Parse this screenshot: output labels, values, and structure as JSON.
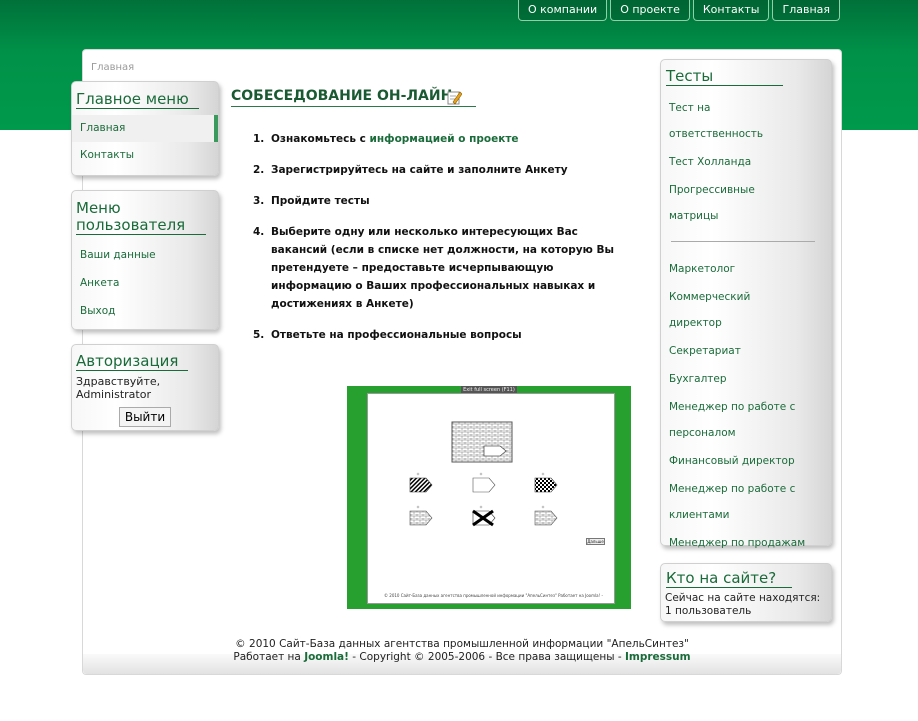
{
  "topnav": [
    "О компании",
    "О проекте",
    "Контакты",
    "Главная"
  ],
  "breadcrumb": "Главная",
  "main_menu": {
    "title": "Главное меню",
    "items": [
      "Главная",
      "Контакты"
    ]
  },
  "user_menu": {
    "title": "Меню пользователя",
    "items": [
      "Ваши данные",
      "Анкета",
      "Выход"
    ]
  },
  "auth": {
    "title": "Авторизация",
    "greeting": "Здравствуйте,",
    "username": "Administrator",
    "logout_label": "Выйти"
  },
  "content": {
    "title": "СОБЕСЕДОВАНИЕ ОН-ЛАЙН",
    "steps": [
      {
        "num": "1.",
        "text": "Ознакомьтесь с ",
        "link": "информацией о проекте"
      },
      {
        "num": "2.",
        "text": "Зарегистрируйтесь на сайте и заполните Анкету"
      },
      {
        "num": "3.",
        "text": "Пройдите тесты"
      },
      {
        "num": "4.",
        "text": "Выберите одну или несколько интересующих Вас вакансий (если в списке нет должности, на которую Вы претендуете – предоставьте исчерпывающую информацию о Ваших профессиональных навыках и достижениях в Анкете)"
      },
      {
        "num": "5.",
        "text": "Ответьте на профессиональные вопросы"
      }
    ]
  },
  "applet": {
    "fullscreen_label": "Exit full screen (F11)",
    "next_label": "Дальше",
    "copyright": "© 2010 Сайт-База данных агентства промышленной информации \"АпельСинтез\" Работает на Joomla! - Copyright © 2005-2006 - Все права защищены - Impressum"
  },
  "tests": {
    "title": "Тесты",
    "group1": [
      "Тест на ответственность",
      "Тест Холланда",
      "Прогрессивные матрицы"
    ],
    "group2": [
      "Маркетолог",
      "Коммерческий директор",
      "Секретариат",
      "Бухгалтер",
      "Менеджер по работе с персоналом",
      "Финансовый директор",
      "Менеджер по работе с клиентами",
      "Менеджер по продажам"
    ]
  },
  "who": {
    "title": "Кто на сайте?",
    "line1": "Сейчас на сайте находятся:",
    "line2": "1 пользователь"
  },
  "footer": {
    "line1": "© 2010 Сайт-База данных агентства промышленной информации \"АпельСинтез\"",
    "line2_prefix": "Работает на ",
    "joomla": "Joomla!",
    "line2_mid": " - Copyright © 2005-2006 - Все права защищены - ",
    "impressum": "Impressum"
  }
}
